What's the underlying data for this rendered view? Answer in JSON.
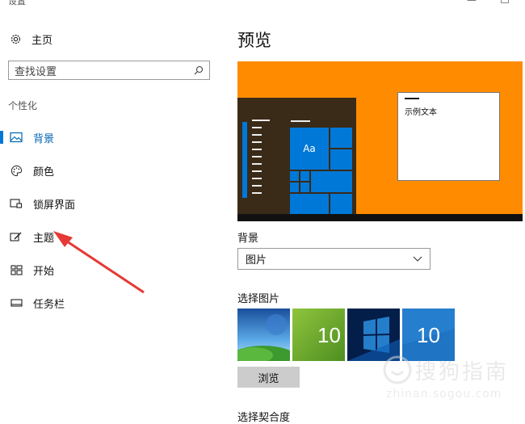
{
  "window": {
    "title": "设置",
    "minimize_glyph": "—"
  },
  "sidebar": {
    "home_label": "主页",
    "search_placeholder": "查找设置",
    "section_title": "个性化",
    "items": [
      {
        "label": "背景",
        "icon": "image-icon",
        "active": true
      },
      {
        "label": "颜色",
        "icon": "palette-icon",
        "active": false
      },
      {
        "label": "锁屏界面",
        "icon": "lockscreen-icon",
        "active": false
      },
      {
        "label": "主题",
        "icon": "theme-icon",
        "active": false
      },
      {
        "label": "开始",
        "icon": "start-icon",
        "active": false
      },
      {
        "label": "任务栏",
        "icon": "taskbar-icon",
        "active": false
      }
    ]
  },
  "main": {
    "preview_title": "预览",
    "preview": {
      "tile_text": "Aa",
      "sample_text": "示例文本",
      "background_color": "#ff8c00",
      "accent_color": "#0078d7"
    },
    "background_label": "背景",
    "background_dropdown_value": "图片",
    "choose_picture_label": "选择图片",
    "thumbnails": [
      "landscape",
      "windows-10-green",
      "windows-light-blue",
      "windows-10-blue"
    ],
    "thumbnail_text": "10",
    "browse_label": "浏览",
    "fit_label": "选择契合度"
  },
  "watermark": {
    "text": "搜狗指南",
    "url": "zhinan.sogou.com"
  },
  "colors": {
    "accent": "#0078d7",
    "active_text": "#0063b1",
    "arrow": "#e53935"
  }
}
